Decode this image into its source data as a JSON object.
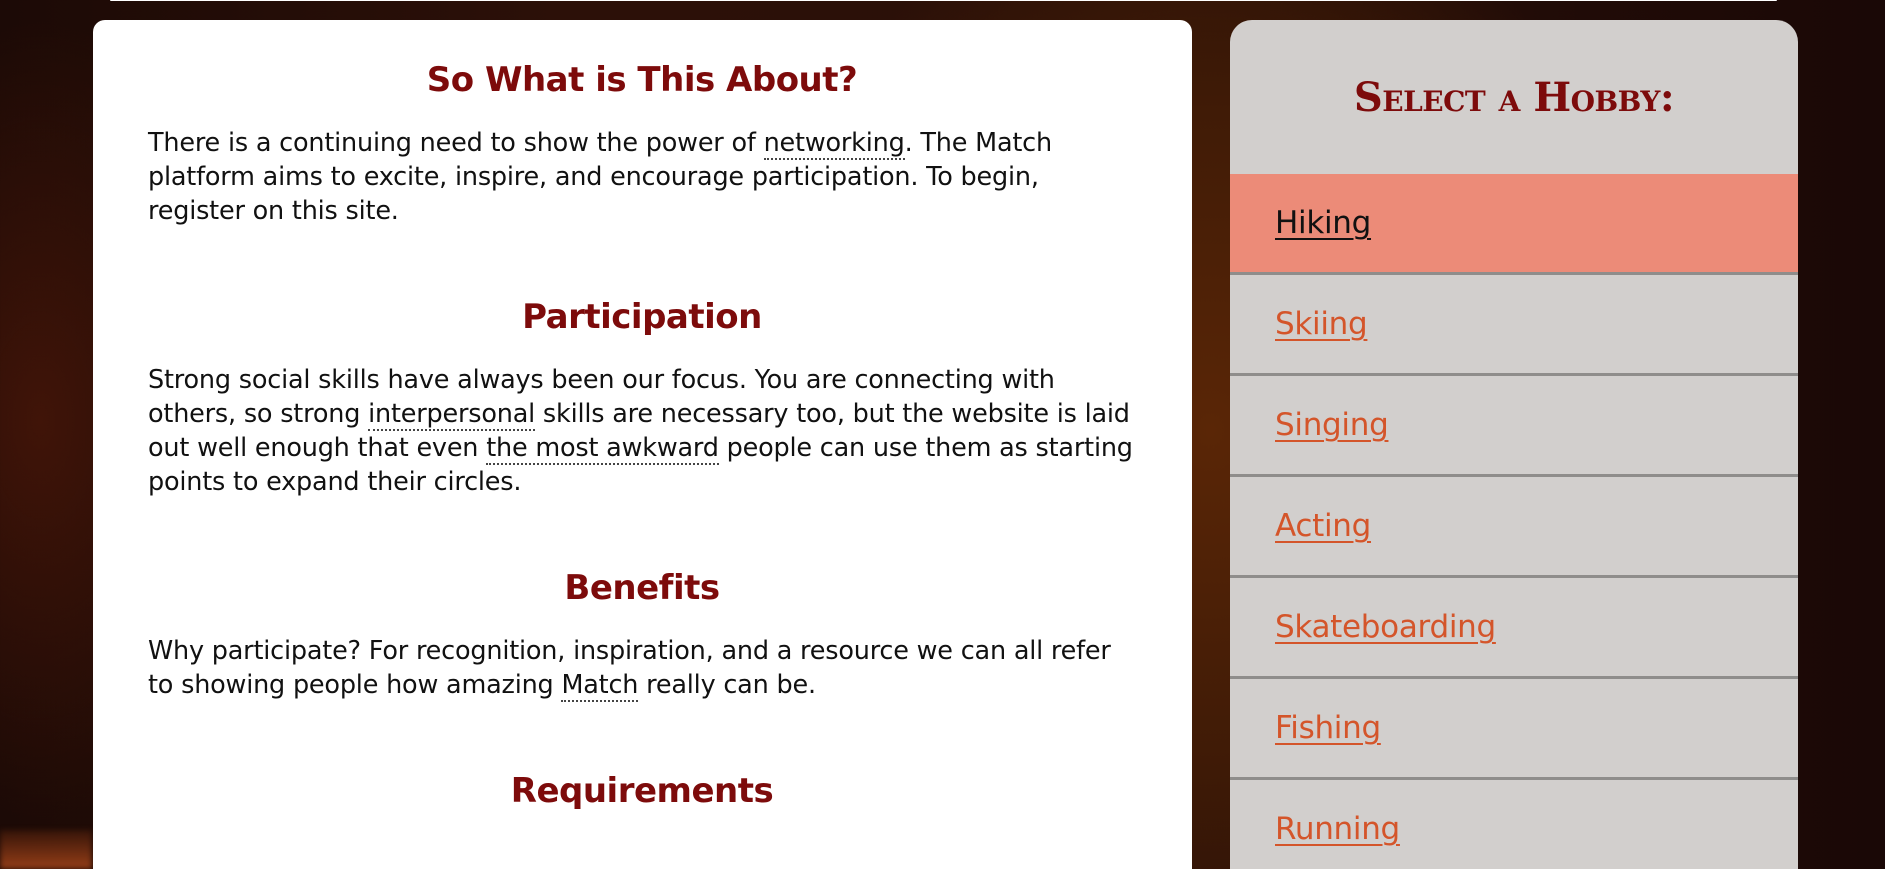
{
  "main": {
    "sections": [
      {
        "heading": "So What is This About?",
        "parts": [
          "There is a continuing need to show the power of ",
          "networking",
          ". The Match platform aims to excite, inspire, and encourage participation. To begin, register on this site."
        ]
      },
      {
        "heading": "Participation",
        "parts": [
          "Strong social skills have always been our focus. You are connecting with others, so strong ",
          "interpersonal",
          " skills are necessary too, but the website is laid out well enough that even ",
          "the most awkward",
          " people can use them as starting points to expand their circles."
        ]
      },
      {
        "heading": "Benefits",
        "parts": [
          "Why participate? For recognition, inspiration, and a resource we can all refer to showing people how amazing ",
          "Match",
          " really can be."
        ]
      },
      {
        "heading": "Requirements"
      }
    ]
  },
  "sidebar": {
    "title": "Select a Hobby:",
    "hobbies": [
      {
        "label": "Hiking",
        "active": true
      },
      {
        "label": "Skiing"
      },
      {
        "label": "Singing"
      },
      {
        "label": "Acting"
      },
      {
        "label": "Skateboarding"
      },
      {
        "label": "Fishing"
      },
      {
        "label": "Running"
      }
    ]
  },
  "colors": {
    "heading": "#7d0b0b",
    "link": "#d4552a",
    "active_row": "#ec8b78",
    "sidebar_bg": "#d2cfcd"
  }
}
